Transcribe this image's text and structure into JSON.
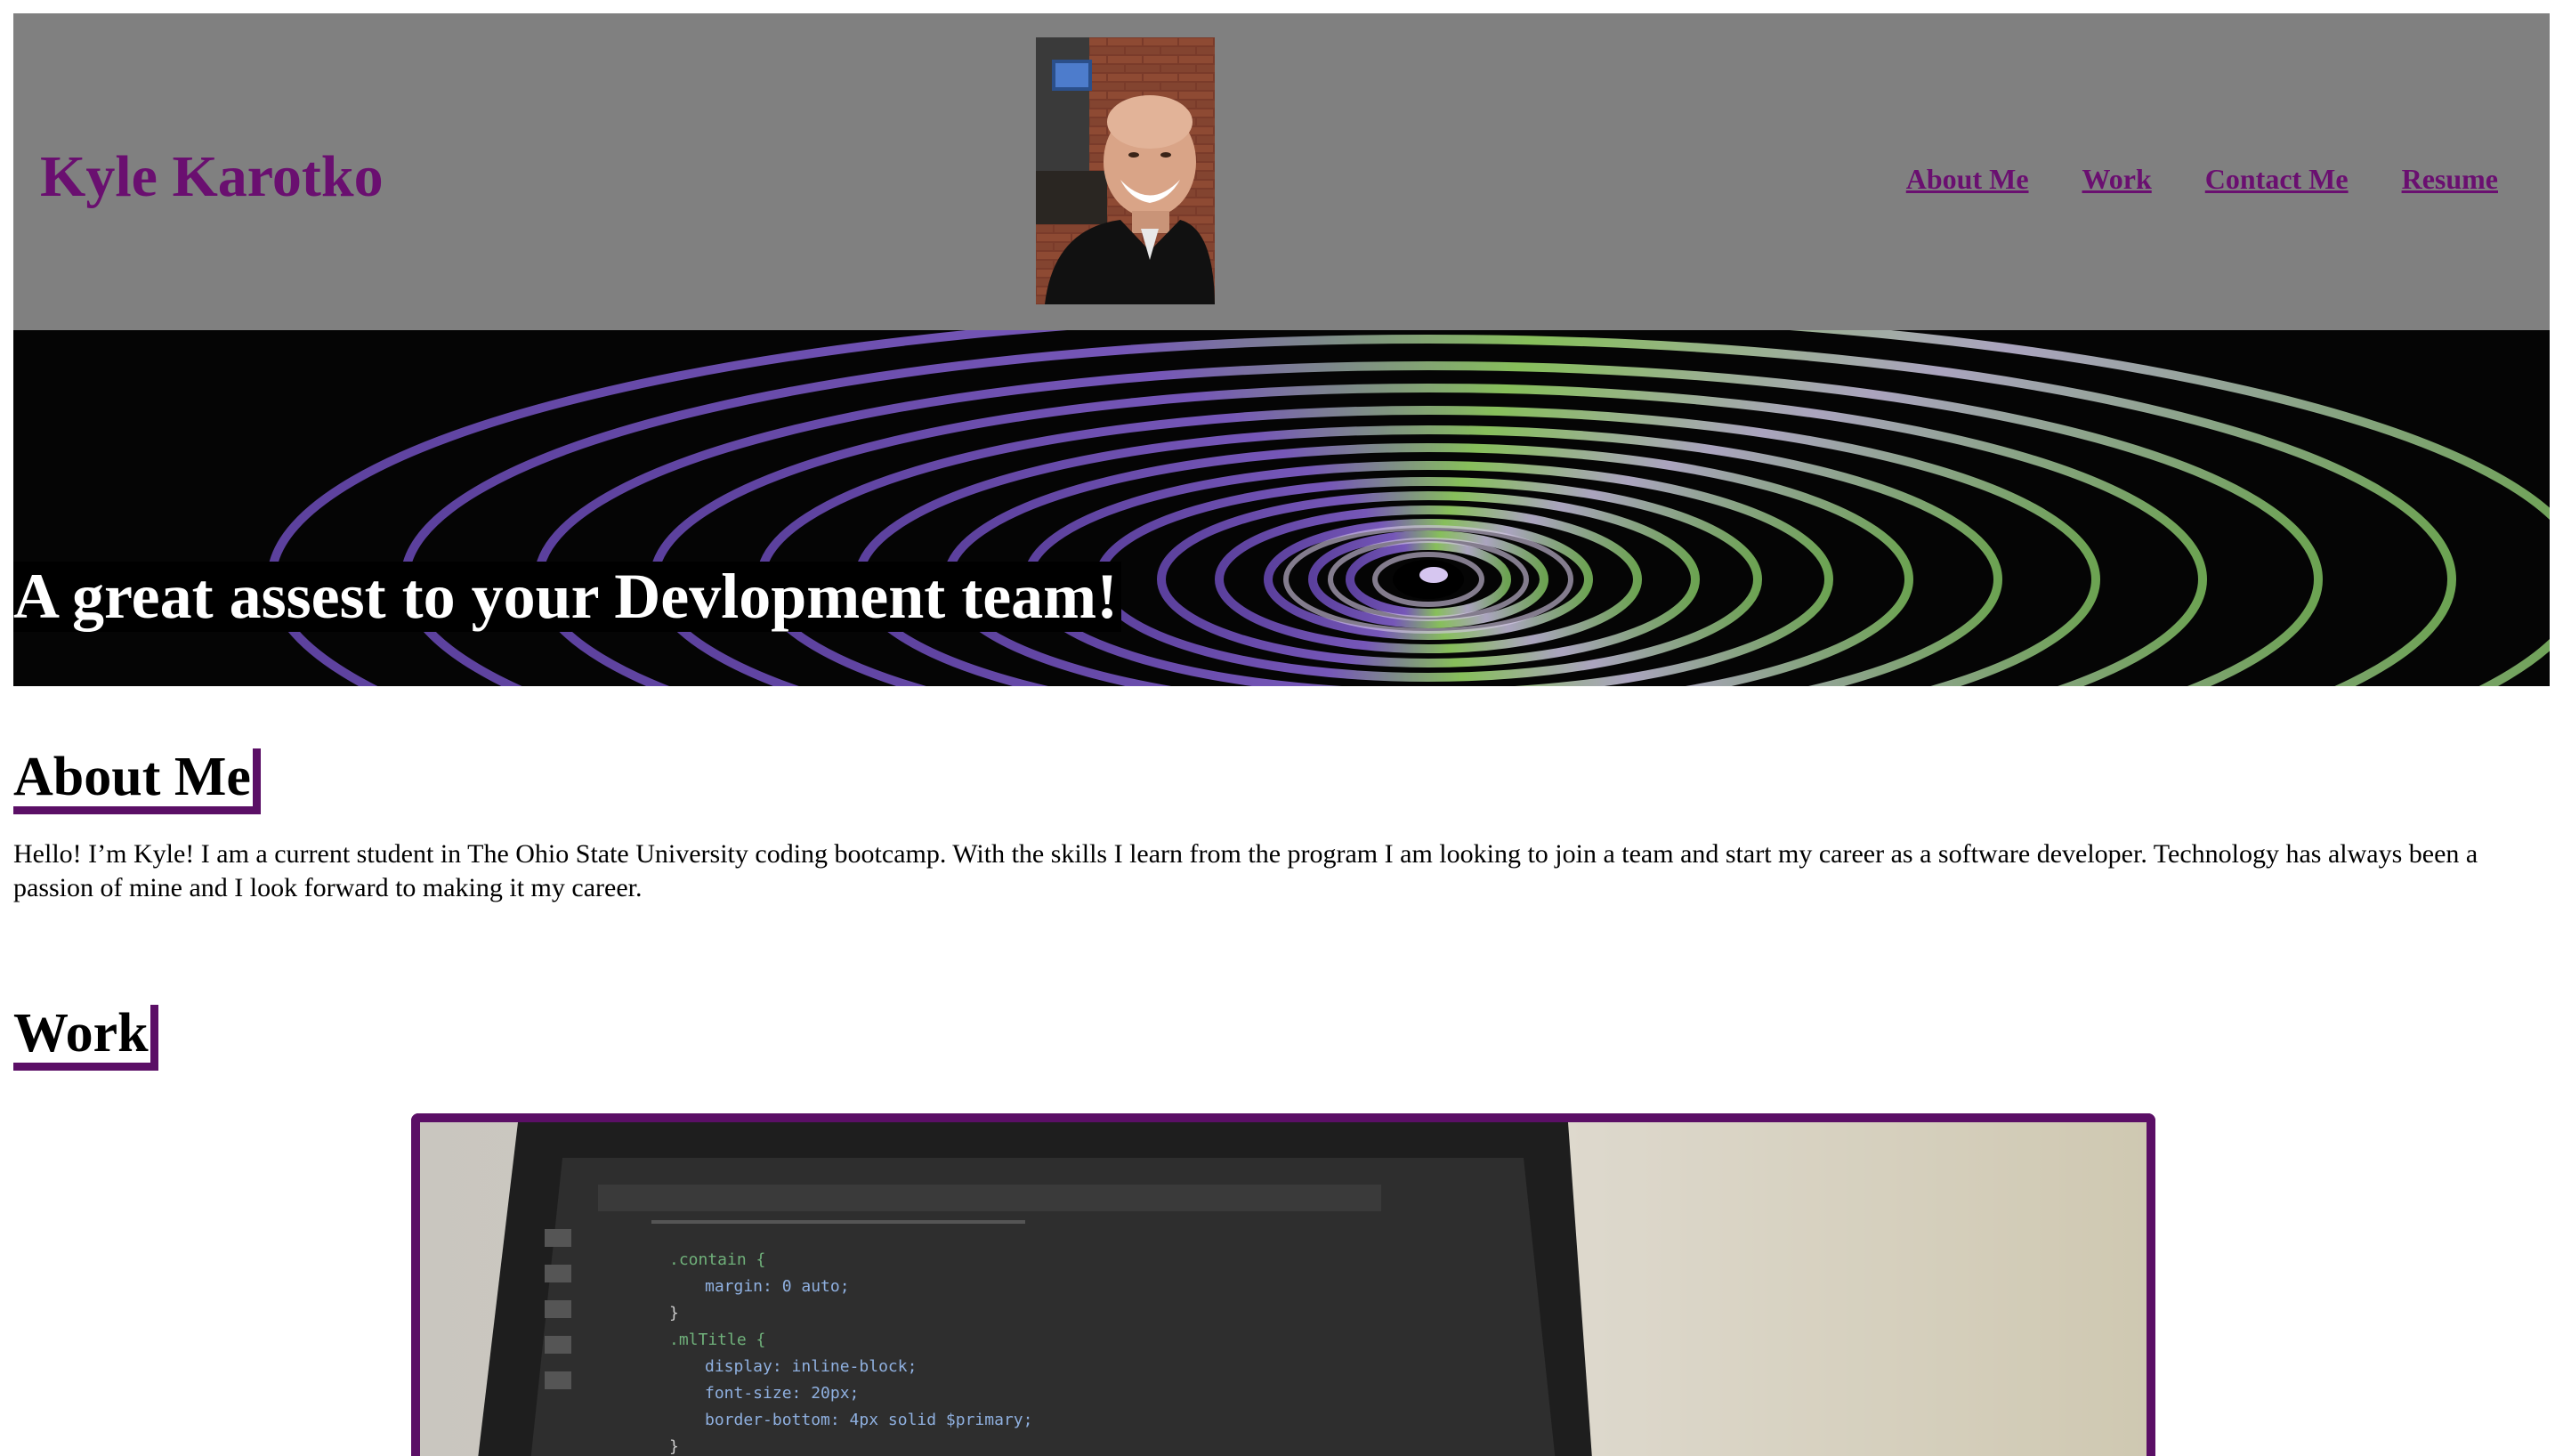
{
  "header": {
    "title": "Kyle Karotko",
    "nav": [
      {
        "label": "About Me"
      },
      {
        "label": "Work"
      },
      {
        "label": "Contact Me"
      },
      {
        "label": "Resume"
      }
    ]
  },
  "hero": {
    "tagline": "A great assest to your Devlopment team!"
  },
  "about": {
    "heading": "About Me",
    "body": "Hello! I’m Kyle! I am a current student in The Ohio State University coding bootcamp. With the skills I learn from the program I am looking to join a team and start my career as a software developer. Technology has always been a passion of mine and I look forward to making it my career."
  },
  "work": {
    "heading": "Work"
  },
  "colors": {
    "accent": "#6a0f70",
    "header_bg": "#808080",
    "border": "#5b0f66"
  }
}
